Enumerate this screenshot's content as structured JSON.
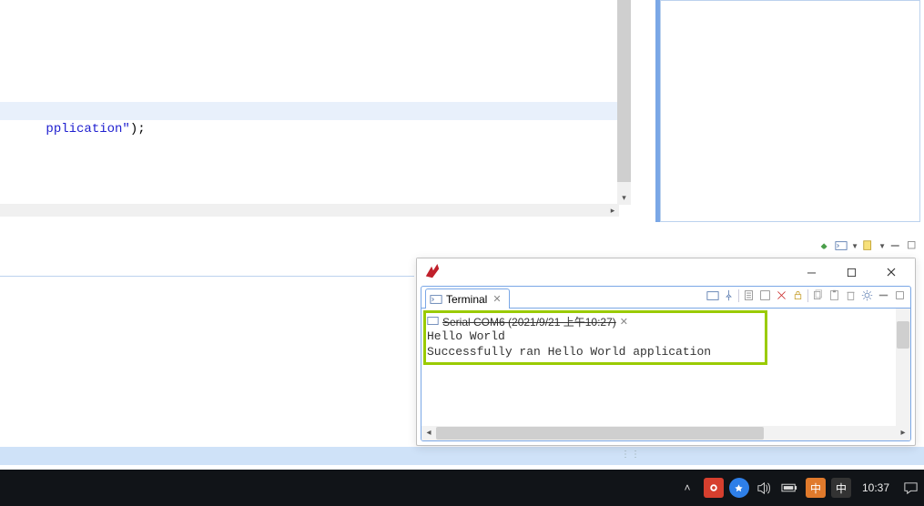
{
  "editor": {
    "code_fragment_string": "pplication\"",
    "code_fragment_tail": ");"
  },
  "terminal_window": {
    "tab_label": "Terminal",
    "console_header": "Serial COM6 (2021/9/21 上午10:27)",
    "console_lines": "Hello World\nSuccessfully ran Hello World application"
  },
  "taskbar": {
    "clock": "10:37",
    "ime": "中",
    "orange_badge": "中"
  }
}
